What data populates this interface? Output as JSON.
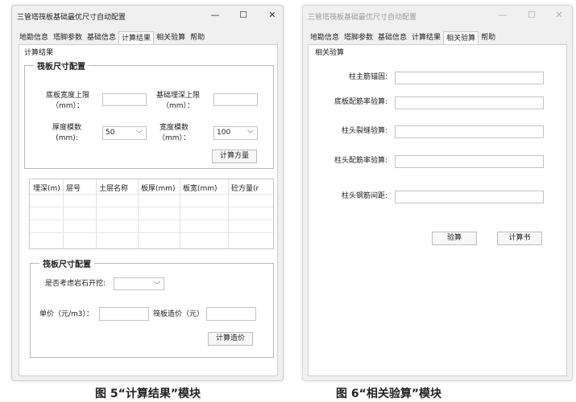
{
  "window_calc": {
    "title": "三管塔筏板基础最优尺寸自动配置",
    "controls": {
      "minimize": "—",
      "maximize": "☐",
      "close": "✕"
    },
    "tabs": [
      "地勘信息",
      "塔脚参数",
      "基础信息",
      "计算结果",
      "相关验算",
      "帮助"
    ],
    "panel_label": "计算结果",
    "group1": {
      "title": "筏板尺寸配置",
      "width_upper_label": "底板宽度上限\n（mm）：",
      "width_upper_value": "",
      "depth_upper_label": "基础埋深上限\n（mm）：",
      "depth_upper_value": "",
      "thickness_modulus_label": "厚度模数\n(mm):",
      "thickness_modulus_value": "50",
      "width_modulus_label": "宽度模数\n（mm）：",
      "width_modulus_value": "100",
      "calc_button": "计算方量"
    },
    "grid_columns": [
      "埋深(m)",
      "层号",
      "土层名称",
      "板厚(mm)",
      "板宽(mm)",
      "砼方量(r"
    ],
    "group2": {
      "title": "筏板尺寸配置",
      "rock_label": "是否考虑岩石开挖:",
      "rock_value": "",
      "unit_price_label": "单价（元/m3）：",
      "unit_price_value": "",
      "cost_label": "筏板造价（元）",
      "cost_value": "",
      "calc_button": "计算造价"
    },
    "caption": "图 5“计算结果”模块"
  },
  "window_check": {
    "title": "三管塔筏板基础最优尺寸自动配置",
    "controls": {
      "minimize": "—",
      "maximize": "☐",
      "close": "✕"
    },
    "tabs": [
      "地勘信息",
      "塔脚参数",
      "基础信息",
      "计算结果",
      "相关验算",
      "帮助"
    ],
    "panel_label": "相关验算",
    "fields": [
      {
        "label": "柱主筋锚固:",
        "value": ""
      },
      {
        "label": "底板配筋率验算:",
        "value": ""
      },
      {
        "label": "柱头裂缝验算:",
        "value": ""
      },
      {
        "label": "柱头配筋率验算:",
        "value": ""
      },
      {
        "label": "柱头钢筋间距:",
        "value": ""
      }
    ],
    "check_button": "验算",
    "report_button": "计算书",
    "caption": "图 6“相关验算”模块"
  },
  "colors": {
    "window_bg": "#f0f0f0",
    "panel_bg": "#ffffff",
    "border": "#c4c4c4"
  }
}
